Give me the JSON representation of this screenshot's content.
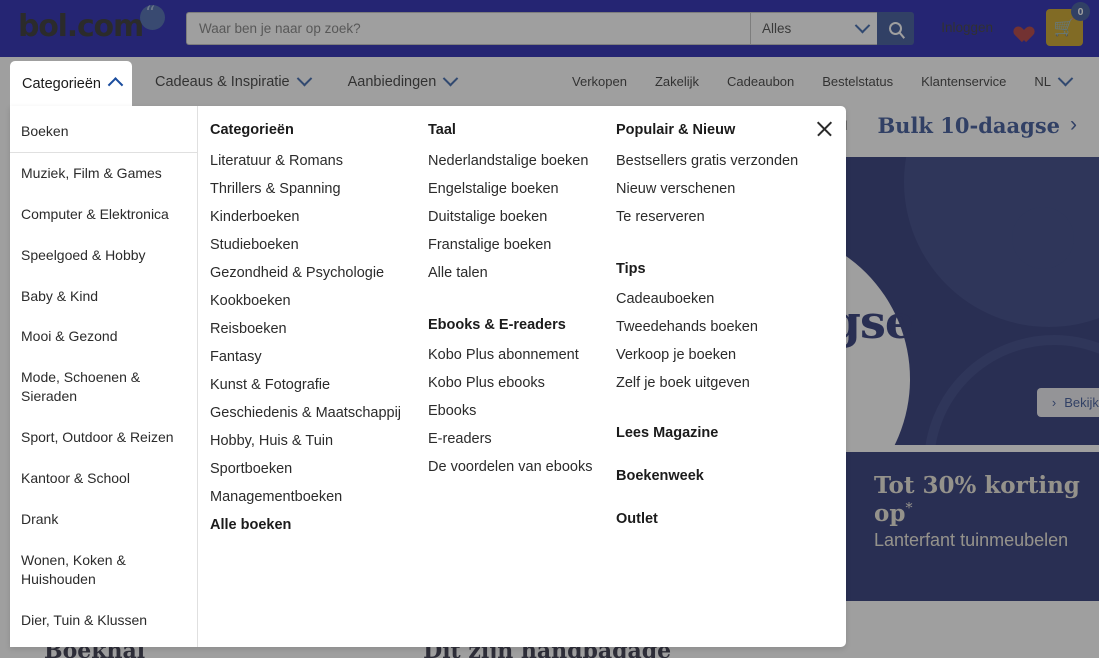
{
  "header": {
    "logo_text": "bol.com",
    "search_placeholder": "Waar ben je naar op zoek?",
    "search_value": "",
    "category_select": "Alles",
    "search_icon": "search-icon",
    "login_label": "Inloggen",
    "wishlist_icon": "heart-icon",
    "cart_icon": "cart-icon",
    "cart_count": "0"
  },
  "nav": {
    "left": [
      {
        "label": "Categorieën",
        "chevron": "chevron-up-icon",
        "active": true
      },
      {
        "label": "Cadeaus & Inspiratie",
        "chevron": "chevron-down-icon",
        "active": false
      },
      {
        "label": "Aanbiedingen",
        "chevron": "chevron-down-icon",
        "active": false
      }
    ],
    "right": [
      {
        "label": "Verkopen",
        "chevron": ""
      },
      {
        "label": "Zakelijk",
        "chevron": ""
      },
      {
        "label": "Cadeaubon",
        "chevron": ""
      },
      {
        "label": "Bestelstatus",
        "chevron": ""
      },
      {
        "label": "Klantenservice",
        "chevron": ""
      },
      {
        "label": "NL",
        "chevron": "chevron-down-icon"
      }
    ]
  },
  "promo_strip": {
    "small_label": "bil",
    "big_label": "Bulk 10-daagse",
    "arrow": "›"
  },
  "mega_menu": {
    "close_icon": "close-icon",
    "sidebar": [
      {
        "label": "Boeken",
        "selected": true
      },
      {
        "label": "Muziek, Film & Games",
        "selected": false
      },
      {
        "label": "Computer & Elektronica",
        "selected": false
      },
      {
        "label": "Speelgoed & Hobby",
        "selected": false
      },
      {
        "label": "Baby & Kind",
        "selected": false
      },
      {
        "label": "Mooi & Gezond",
        "selected": false
      },
      {
        "label": "Mode, Schoenen & Sieraden",
        "selected": false
      },
      {
        "label": "Sport, Outdoor & Reizen",
        "selected": false
      },
      {
        "label": "Kantoor & School",
        "selected": false
      },
      {
        "label": "Drank",
        "selected": false
      },
      {
        "label": "Wonen, Koken & Huishouden",
        "selected": false
      },
      {
        "label": "Dier, Tuin & Klussen",
        "selected": false
      }
    ],
    "column1": {
      "heading": "Categorieën",
      "links": [
        "Literatuur & Romans",
        "Thrillers & Spanning",
        "Kinderboeken",
        "Studieboeken",
        "Gezondheid & Psychologie",
        "Kookboeken",
        "Reisboeken",
        "Fantasy",
        "Kunst & Fotografie",
        "Geschiedenis & Maatschappij",
        "Hobby, Huis & Tuin",
        "Sportboeken",
        "Managementboeken"
      ],
      "footer_link": "Alle boeken"
    },
    "column2": {
      "group1": {
        "heading": "Taal",
        "links": [
          "Nederlandstalige boeken",
          "Engelstalige boeken",
          "Duitstalige boeken",
          "Franstalige boeken",
          "Alle talen"
        ]
      },
      "group2": {
        "heading": "Ebooks & E-readers",
        "links": [
          "Kobo Plus abonnement",
          "Kobo Plus ebooks",
          "Ebooks",
          "E-readers",
          "De voordelen van ebooks"
        ]
      }
    },
    "column3": {
      "group1": {
        "heading": "Populair & Nieuw",
        "links": [
          "Bestsellers gratis verzonden",
          "Nieuw verschenen",
          "Te reserveren"
        ]
      },
      "group2": {
        "heading": "Tips",
        "links": [
          "Cadeauboeken",
          "Tweedehands boeken",
          "Verkoop je boeken",
          "Zelf je boek uitgeven"
        ]
      },
      "standalone": [
        "Lees Magazine",
        "Boekenweek",
        "Outlet"
      ]
    }
  },
  "banner_top": {
    "word": "agse",
    "cta_label": "Bekijk nu",
    "cta_icon": "chevron-right-icon"
  },
  "banner_bottom": {
    "tag_line1": "tot",
    "tag_line2": "30%",
    "tag_line3": "korting*",
    "heading": "Tot 30% korting op",
    "heading_sup": "*",
    "subheading": "Lanterfant tuinmeubelen",
    "next_icon": "chevron-right-icon"
  },
  "below_fold": {
    "left_heading": "Boekhal",
    "right_heading": "Dit zijn handbagage"
  },
  "colors": {
    "brand_blue": "#0a1560",
    "accent_blue": "#1b3a87",
    "cart_yellow": "#c09200",
    "heart_red": "#a31d1d",
    "tag_red": "#a02020"
  }
}
